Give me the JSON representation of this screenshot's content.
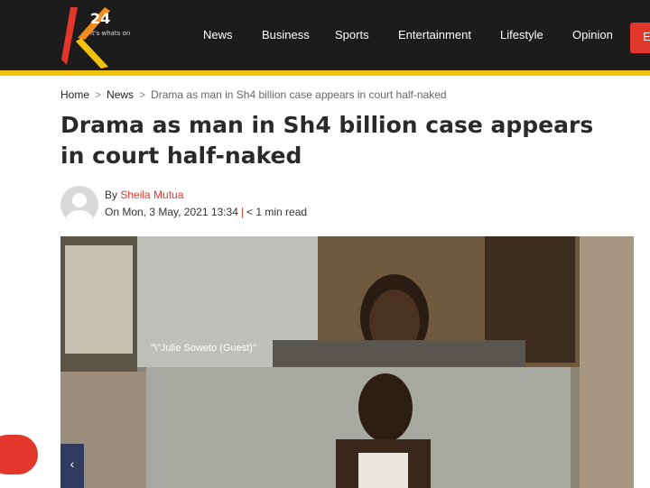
{
  "logo": {
    "brand": "K24",
    "tagline": "it's whats on"
  },
  "nav": {
    "items": [
      "News",
      "Business",
      "Sports",
      "Entertainment",
      "Lifestyle",
      "Opinion"
    ],
    "button_label": "E"
  },
  "breadcrumb": {
    "home": "Home",
    "section": "News",
    "separator": ">",
    "current": "Drama as man in Sh4 billion case appears in court half-naked"
  },
  "article": {
    "title": "Drama as man in Sh4 billion case appears in court half-naked",
    "by_prefix": "By",
    "author": "Sheila Mutua",
    "date": "On Mon, 3 May, 2021 13:34",
    "meta_sep": "|",
    "read_time": "< 1 min read"
  },
  "photo": {
    "participant_label": "\"\\\"Julie Soweto (Guest)\""
  },
  "carousel": {
    "prev_glyph": "‹"
  },
  "colors": {
    "accent": "#e2382b",
    "topbar": "#1c1c1c",
    "stripe": "#f4c20d"
  }
}
